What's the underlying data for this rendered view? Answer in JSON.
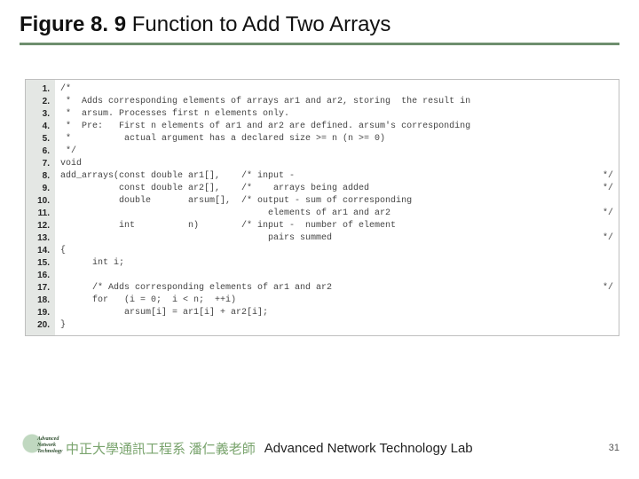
{
  "title": {
    "figno": "Figure 8. 9",
    "caption": " Function to Add Two Arrays"
  },
  "code_lines": [
    {
      "n": "1.",
      "t": "/*",
      "r": ""
    },
    {
      "n": "2.",
      "t": " *  Adds corresponding elements of arrays ar1 and ar2, storing  the result in",
      "r": ""
    },
    {
      "n": "3.",
      "t": " *  arsum. Processes first n elements only.",
      "r": ""
    },
    {
      "n": "4.",
      "t": " *  Pre:   First n elements of ar1 and ar2 are defined. arsum's corresponding",
      "r": ""
    },
    {
      "n": "5.",
      "t": " *          actual argument has a declared size >= n (n >= 0)",
      "r": ""
    },
    {
      "n": "6.",
      "t": " */",
      "r": ""
    },
    {
      "n": "7.",
      "t": "void",
      "r": ""
    },
    {
      "n": "8.",
      "t": "add_arrays(const double ar1[],    /* input -",
      "r": "*/"
    },
    {
      "n": "9.",
      "t": "           const double ar2[],    /*    arrays being added",
      "r": "*/"
    },
    {
      "n": "10.",
      "t": "           double       arsum[],  /* output - sum of corresponding",
      "r": ""
    },
    {
      "n": "11.",
      "t": "                                       elements of ar1 and ar2",
      "r": "*/"
    },
    {
      "n": "12.",
      "t": "           int          n)        /* input -  number of element",
      "r": ""
    },
    {
      "n": "13.",
      "t": "                                       pairs summed",
      "r": "*/"
    },
    {
      "n": "14.",
      "t": "{",
      "r": ""
    },
    {
      "n": "15.",
      "t": "      int i;",
      "r": ""
    },
    {
      "n": "16.",
      "t": "",
      "r": ""
    },
    {
      "n": "17.",
      "t": "      /* Adds corresponding elements of ar1 and ar2",
      "r": "*/"
    },
    {
      "n": "18.",
      "t": "      for   (i = 0;  i < n;  ++i)",
      "r": ""
    },
    {
      "n": "19.",
      "t": "            arsum[i] = ar1[i] + ar2[i];",
      "r": ""
    },
    {
      "n": "20.",
      "t": "}",
      "r": ""
    }
  ],
  "footer": {
    "logo_lines": "Advanced\nNetwork\nTechnology",
    "left": "中正大學通訊工程系 潘仁義老師",
    "mid": "Advanced Network Technology Lab",
    "page": "31"
  }
}
